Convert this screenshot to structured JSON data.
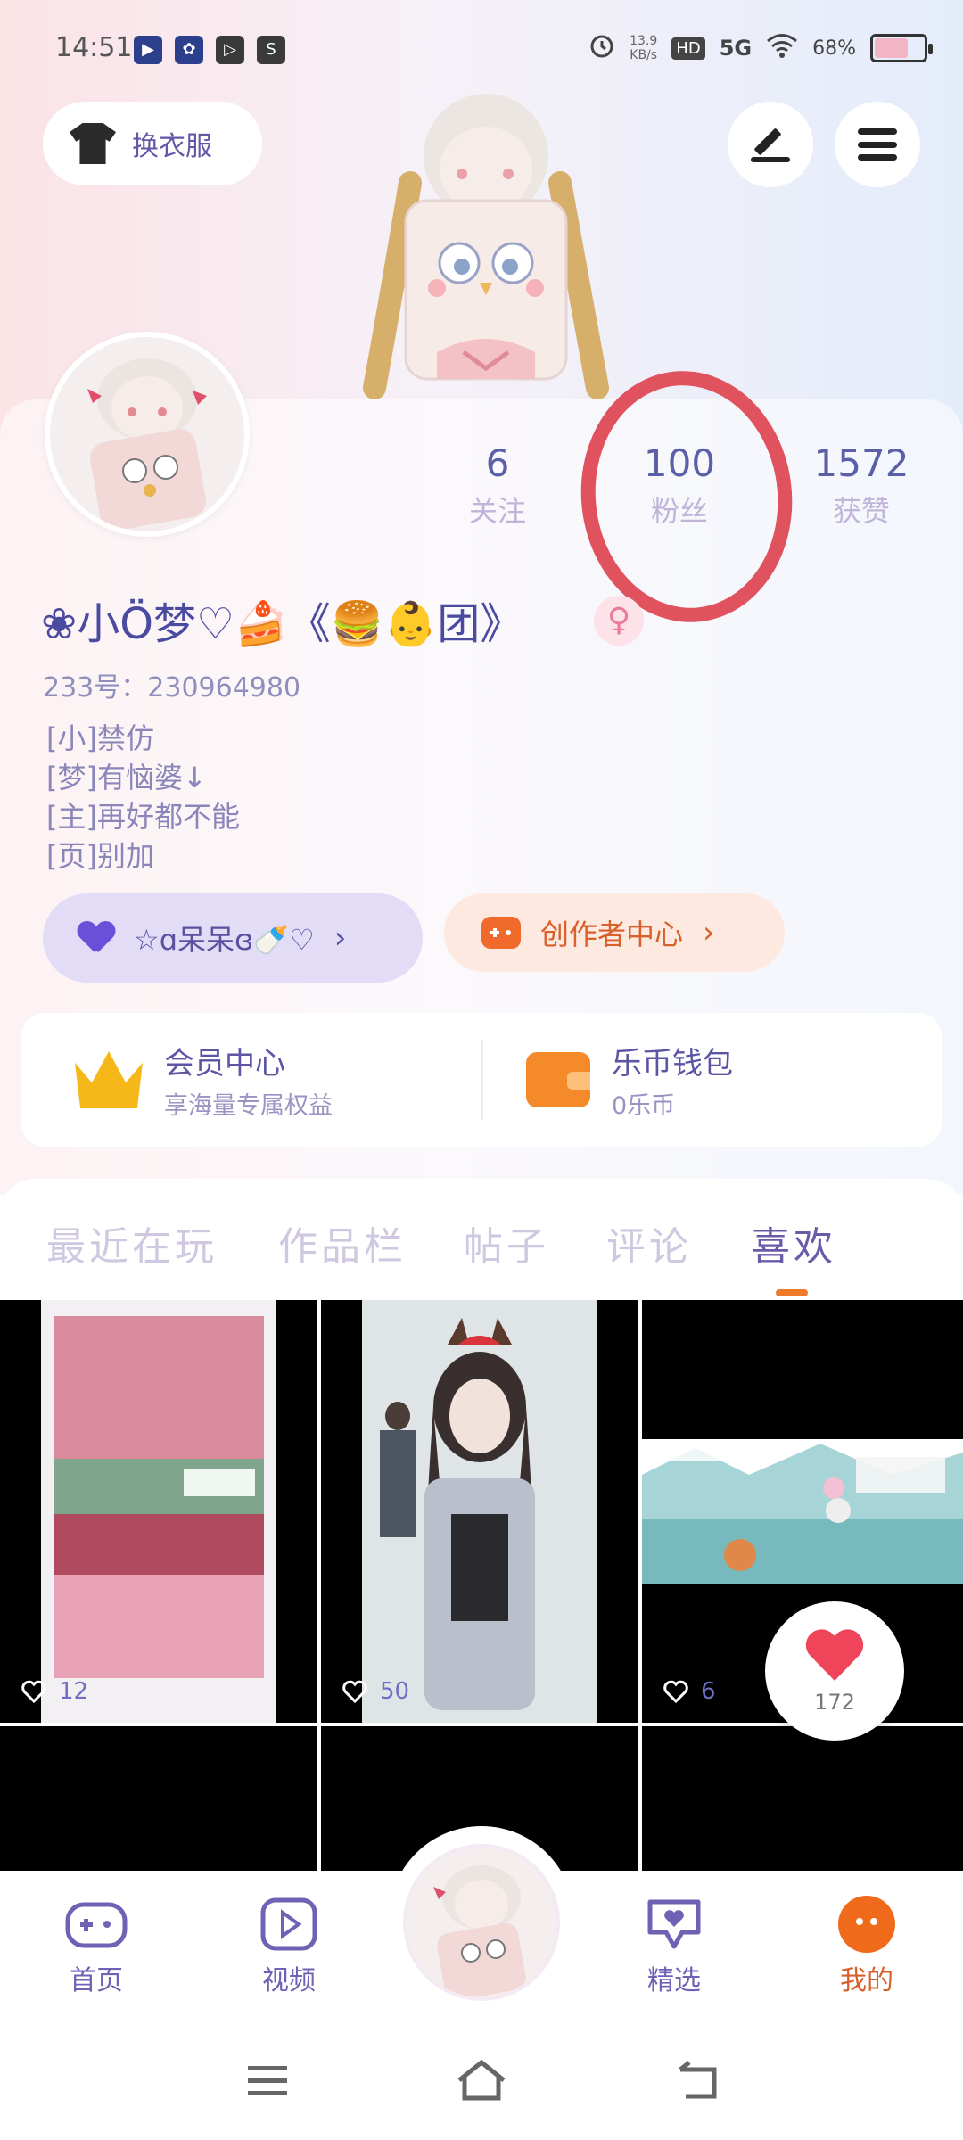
{
  "status_bar": {
    "time": "14:51",
    "net_speed_value": "13.9",
    "net_speed_unit": "KB/s",
    "hd": "HD",
    "network": "5G",
    "battery": "68%",
    "battery_level": 0.68
  },
  "header": {
    "dress_label": "换衣服",
    "edit_icon": "pen-icon",
    "menu_icon": "menu-icon"
  },
  "profile": {
    "nickname": "❀小Ö梦♡🍰《🍔👶团》",
    "gender_symbol": "♀",
    "uid_label": "233号：",
    "uid_value": "230964980",
    "bio_lines": [
      "[小]禁仿",
      "[梦]有恼婆↓",
      "[主]再好都不能",
      "[页]别加"
    ],
    "stats": [
      {
        "value": "6",
        "label": "关注"
      },
      {
        "value": "100",
        "label": "粉丝"
      },
      {
        "value": "1572",
        "label": "获赞"
      }
    ]
  },
  "tag_pill": {
    "label": "☆ɑ呆呆ɞ🍼♡",
    "chevron": "›"
  },
  "creator": {
    "label": "创作者中心",
    "chevron": "›"
  },
  "vip": {
    "member_title": "会员中心",
    "member_sub": "享海量专属权益",
    "wallet_title": "乐币钱包",
    "wallet_sub": "0乐币"
  },
  "tabs": [
    "最近在玩",
    "作品栏",
    "帖子",
    "评论",
    "喜欢"
  ],
  "active_tab": 4,
  "grid_items": [
    {
      "likes": "12"
    },
    {
      "likes": "50"
    },
    {
      "likes": "6"
    }
  ],
  "float_like": {
    "count": "172"
  },
  "bottom_nav": [
    {
      "label": "首页",
      "icon": "gamepad-icon"
    },
    {
      "label": "视频",
      "icon": "play-icon"
    },
    {
      "label": "精选",
      "icon": "heart-chat-icon"
    },
    {
      "label": "我的",
      "icon": "face-icon"
    }
  ],
  "colors": {
    "accent": "#6a5aa8",
    "orange": "#ee7a2a",
    "like_red": "#f0445a",
    "circle_annotation": "#e0525e"
  }
}
